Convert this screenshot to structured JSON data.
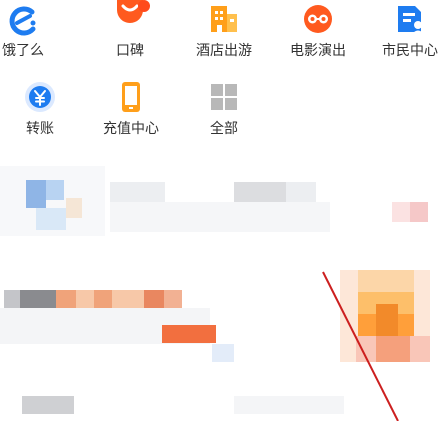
{
  "apps": [
    {
      "label": "饿了么",
      "icon": "eleme-icon",
      "color": "#1e7cf0",
      "badge": ""
    },
    {
      "label": "口碑",
      "icon": "koubei-icon",
      "color": "#ff5a1f",
      "badge": ""
    },
    {
      "label": "酒店出游",
      "icon": "hotel-icon",
      "color": "#ff9f1a",
      "badge": ""
    },
    {
      "label": "电影演出",
      "icon": "movie-icon",
      "color": "#ff5a1f",
      "badge": ""
    },
    {
      "label": "市民中心",
      "icon": "citizen-center-icon",
      "color": "#1e7cf0",
      "badge": ""
    },
    {
      "label": "转账",
      "icon": "transfer-icon",
      "color": "#1e7cf0",
      "badge": ""
    },
    {
      "label": "充值中心",
      "icon": "recharge-icon",
      "color": "#ff9f1a",
      "badge": ""
    },
    {
      "label": "全部",
      "icon": "all-apps-icon",
      "color": "#b8b8b8",
      "badge": ""
    }
  ],
  "colors": {
    "blue": "#1e7cf0",
    "orange": "#ff9f1a",
    "red": "#ff5a1f",
    "gray": "#b8b8b8",
    "annotation_line": "#cc1f1f"
  }
}
